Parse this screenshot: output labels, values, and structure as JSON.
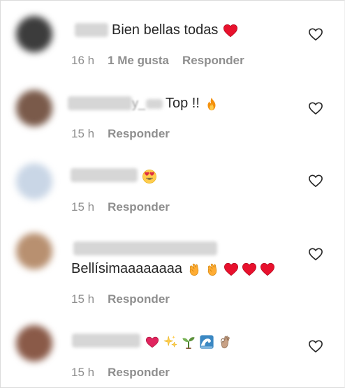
{
  "comments": [
    {
      "text": "Bien bellas todas",
      "emojis": [
        "red-heart-icon"
      ],
      "time": "16 h",
      "likes": "1 Me gusta",
      "reply": "Responder",
      "avatar_color": "#3c3c3c"
    },
    {
      "name_tail": "y_",
      "text": "Top !!",
      "emojis": [
        "fire-icon"
      ],
      "time": "15 h",
      "reply": "Responder",
      "avatar_color": "#7a5a4a"
    },
    {
      "text": "",
      "emojis": [
        "heart-eyes-icon"
      ],
      "time": "15 h",
      "reply": "Responder",
      "avatar_color": "#c9d6e6"
    },
    {
      "text": "Bellísimaaaaaaaa",
      "emojis": [
        "clapping-hands-icon",
        "clapping-hands-icon",
        "red-heart-icon",
        "red-heart-icon",
        "red-heart-icon"
      ],
      "time": "15 h",
      "reply": "Responder",
      "avatar_color": "#b89070"
    },
    {
      "text": "",
      "emojis": [
        "heart-icon",
        "sparkles-icon",
        "seedling-icon",
        "water-wave-icon",
        "ok-hand-icon"
      ],
      "time": "15 h",
      "reply": "Responder",
      "avatar_color": "#8a5a48"
    }
  ]
}
